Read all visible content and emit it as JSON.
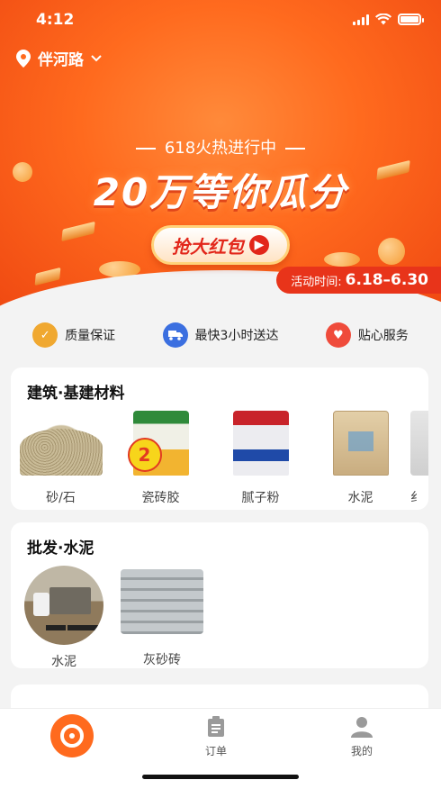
{
  "status_bar": {
    "time": "4:12"
  },
  "location": {
    "name": "伴河路"
  },
  "banner": {
    "subtitle": "618火热进行中",
    "title": "20万等你瓜分",
    "cta": "抢大红包",
    "activity_label": "活动时间:",
    "activity_range": "6.18–6.30"
  },
  "badges": [
    {
      "label": "质量保证",
      "icon": "shield-check-icon",
      "color": "#f0a830"
    },
    {
      "label": "最快3小时送达",
      "icon": "truck-icon",
      "color": "#3b6fe0"
    },
    {
      "label": "贴心服务",
      "icon": "heart-icon",
      "color": "#ef4b3b"
    }
  ],
  "section_building": {
    "title": "建筑·基建材料",
    "items": [
      "砂/石",
      "瓷砖胶",
      "腻子粉",
      "水泥",
      "纟"
    ]
  },
  "section_wholesale": {
    "title": "批发·水泥",
    "items": [
      "水泥",
      "灰砂砖"
    ]
  },
  "tabbar": {
    "order": "订单",
    "me": "我的"
  },
  "colors": {
    "accent": "#ff6a1e"
  }
}
